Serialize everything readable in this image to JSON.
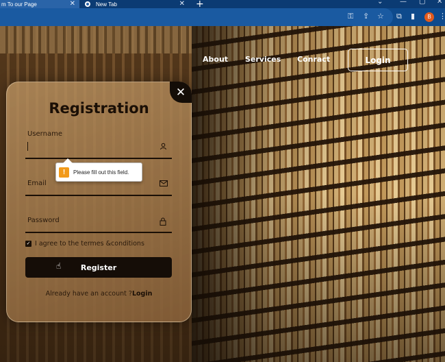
{
  "browser": {
    "tabs": [
      {
        "title": "m To our Page",
        "active": true
      },
      {
        "title": "New Tab",
        "active": false
      }
    ],
    "new_tab": "+",
    "close_glyph": "✕",
    "profile_initial": "B",
    "toolbar_icons": [
      "key-icon",
      "share-icon",
      "star-icon",
      "extensions-icon",
      "sidepanel-icon",
      "profile-icon",
      "menu-icon"
    ]
  },
  "nav": {
    "links": [
      "About",
      "Services",
      "Conract"
    ],
    "login": "Login"
  },
  "form": {
    "title": "Registration",
    "close_glyph": "✕",
    "username_label": "Username",
    "email_label": "Email",
    "password_label": "Password",
    "validation_message": "Please fill out this field.",
    "validation_icon": "!",
    "agree_text": "I agree to the termes &conditions",
    "agree_checked": true,
    "register_label": "Register",
    "account_prompt": "Already have an account ?",
    "account_link": "Login"
  },
  "colors": {
    "card_dark": "#150d07",
    "warning": "#f29a1a",
    "tab_bar": "#0b3b73"
  }
}
